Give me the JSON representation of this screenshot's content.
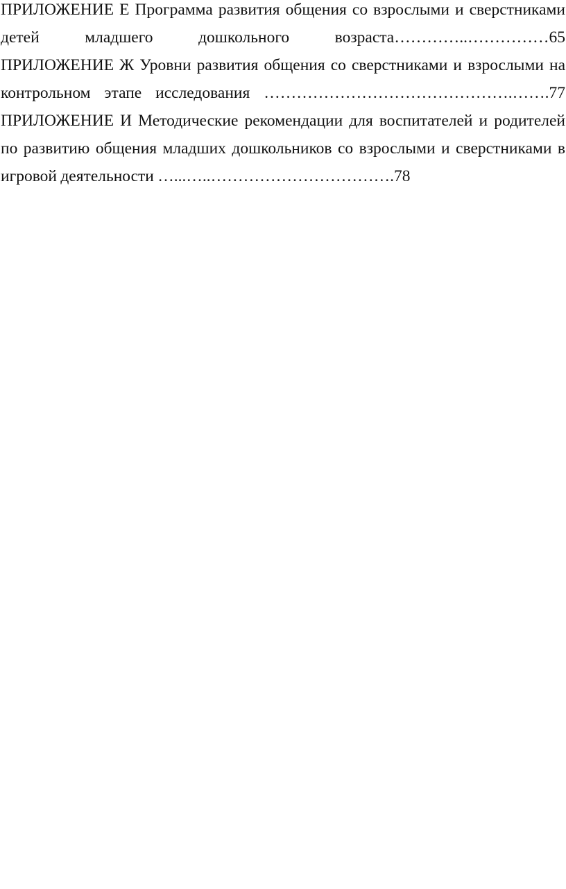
{
  "document": {
    "page_background": "#ffffff",
    "text_color": "#111111",
    "entries": [
      {
        "id": "appendix-e",
        "label": "ПРИЛОЖЕНИЕ Е",
        "title": "Программа развития общения со взрослыми и сверстниками детей младшего дошкольного возраста",
        "leader": "…………..……………",
        "page": "65",
        "full_text": "ПРИЛОЖЕНИЕ Е Программа развития общения со взрослыми и сверстниками детей младшего дошкольного возраста…………..……………65"
      },
      {
        "id": "appendix-zh",
        "label": "ПРИЛОЖЕНИЕ Ж",
        "title": "Уровни развития общения со сверстниками и взрослыми на контрольном этапе исследования",
        "leader": " ……………………………………….…….",
        "page": "77",
        "full_text": "ПРИЛОЖЕНИЕ Ж Уровни развития общения со сверстниками и взрослыми на контрольном этапе исследования ……………………………………….…….77"
      },
      {
        "id": "appendix-i",
        "label": "ПРИЛОЖЕНИЕ И",
        "title": "Методические рекомендации для воспитателей и родителей по развитию общения младших дошкольников со взрослыми и сверстниками в игровой деятельности",
        "leader": " …...…..…………………………….",
        "page": "78",
        "full_text": "ПРИЛОЖЕНИЕ И Методические рекомендации для воспитателей и родителей по развитию общения младших дошкольников со взрослыми и сверстниками в игровой деятельности …...…..…………………………….78"
      }
    ]
  }
}
